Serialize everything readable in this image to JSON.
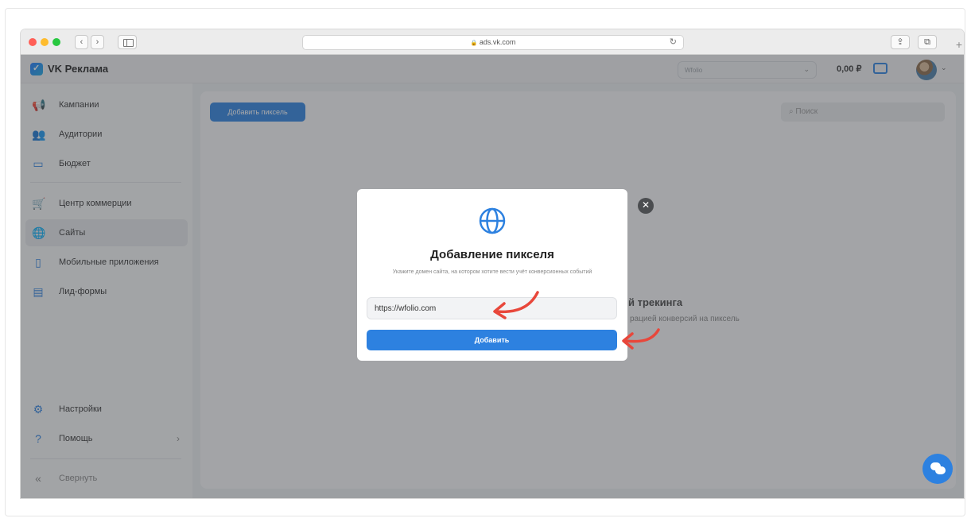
{
  "browser": {
    "url": "ads.vk.com",
    "lock_icon": "🔒"
  },
  "header": {
    "app_name": "VK Реклама",
    "account": "Wfolio",
    "balance": "0,00 ₽"
  },
  "sidebar": {
    "items": [
      {
        "label": "Кампании",
        "icon": "megaphone-icon"
      },
      {
        "label": "Аудитории",
        "icon": "audience-icon"
      },
      {
        "label": "Бюджет",
        "icon": "wallet-icon"
      },
      {
        "label": "Центр коммерции",
        "icon": "cart-icon"
      },
      {
        "label": "Сайты",
        "icon": "globe-icon"
      },
      {
        "label": "Мобильные приложения",
        "icon": "phone-icon"
      },
      {
        "label": "Лид-формы",
        "icon": "form-icon"
      }
    ],
    "settings": "Настройки",
    "help": "Помощь",
    "collapse": "Свернуть"
  },
  "main": {
    "add_pixel_button": "Добавить пиксель",
    "search_placeholder": "Поиск",
    "empty_title": "й трекинга",
    "empty_desc": "рацией конверсий на пиксель"
  },
  "modal": {
    "title": "Добавление пикселя",
    "description": "Укажите домен сайта, на котором хотите вести учёт конверсионных событий",
    "input_value": "https://wfolio.com",
    "submit_label": "Добавить"
  },
  "colors": {
    "accent": "#2d81e0",
    "annotation_arrow": "#e8473b"
  }
}
